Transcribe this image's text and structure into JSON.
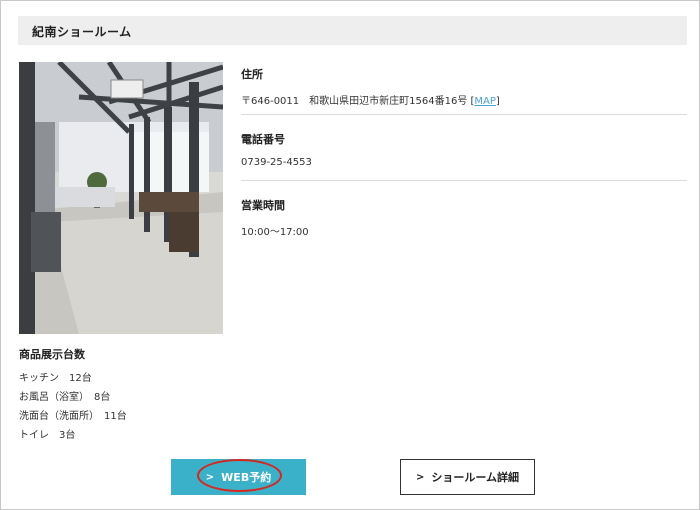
{
  "header": {
    "title": "紀南ショールーム"
  },
  "info": {
    "address_label": "住所",
    "address_value": "〒646-0011　和歌山県田辺市新庄町1564番16号 [",
    "map_link": "MAP",
    "address_suffix": "]",
    "phone_label": "電話番号",
    "phone_value": "0739-25-4553",
    "hours_label": "営業時間",
    "hours_value": "10:00〜17:00"
  },
  "stock": {
    "title": "商品展示台数",
    "items": [
      "キッチン　12台",
      "お風呂（浴室）　8台",
      "洗面台（洗面所）　11台",
      "トイレ　3台"
    ]
  },
  "buttons": {
    "web_reserve": "WEB予約",
    "showroom_detail": "ショールーム詳細",
    "chevron": ">"
  },
  "colors": {
    "accent": "#3bb0c9",
    "highlight": "#d7261e",
    "link": "#4aa3d8"
  }
}
